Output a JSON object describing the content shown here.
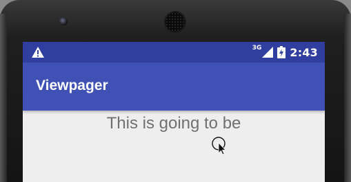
{
  "status_bar": {
    "network_label": "3G",
    "time": "2:43",
    "icons": [
      "warning-icon",
      "signal-icon",
      "battery-icon"
    ]
  },
  "app_bar": {
    "title": "Viewpager"
  },
  "content": {
    "text": "This is going to be"
  },
  "colors": {
    "status_bar": "#303f9f",
    "app_bar": "#3f51b5",
    "screen_background": "#eeeeee",
    "content_text": "#707070"
  }
}
